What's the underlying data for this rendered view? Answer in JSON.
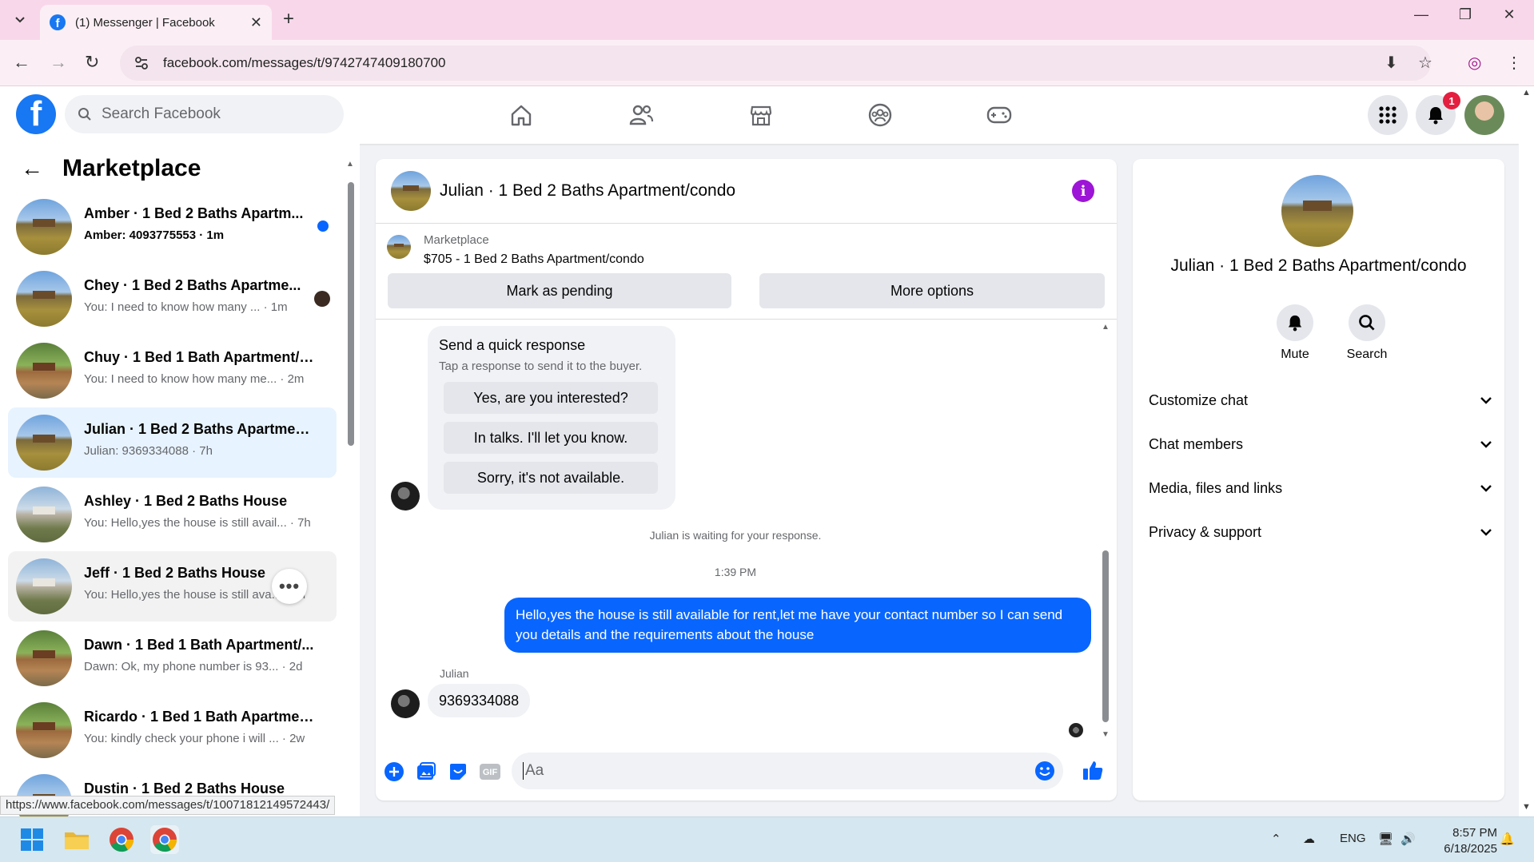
{
  "browser": {
    "tab_title": "(1) Messenger | Facebook",
    "url": "facebook.com/messages/t/9742747409180700",
    "status_url": "https://www.facebook.com/messages/t/10071812149572443/"
  },
  "fb_header": {
    "search_placeholder": "Search Facebook",
    "notification_count": "1"
  },
  "sidebar": {
    "title": "Marketplace",
    "conversations": [
      {
        "name": "Amber · 1 Bed 2 Baths Apartm...",
        "preview": "Amber: 4093775553 · 1m",
        "unread": true
      },
      {
        "name": "Chey · 1 Bed 2 Baths Apartme...",
        "preview": "You: I need to know how many ... · 1m"
      },
      {
        "name": "Chuy · 1 Bed 1 Bath Apartment/c...",
        "preview": "You: I need to know how many me... · 2m"
      },
      {
        "name": "Julian · 1 Bed 2 Baths Apartment...",
        "preview": "Julian: 9369334088 · 7h",
        "selected": true
      },
      {
        "name": "Ashley · 1 Bed 2 Baths House",
        "preview": "You: Hello,yes the house is still avail... · 7h"
      },
      {
        "name": "Jeff · 1 Bed 2 Baths House",
        "preview": "You: Hello,yes the house is still ava... · 7h"
      },
      {
        "name": "Dawn · 1 Bed 1 Bath Apartment/...",
        "preview": "Dawn: Ok, my phone number is 93... · 2d"
      },
      {
        "name": "Ricardo · 1 Bed 1 Bath Apartmen...",
        "preview": "You: kindly check your phone i will ... · 2w"
      },
      {
        "name": "Dustin · 1 Bed 2 Baths House",
        "preview": ""
      }
    ]
  },
  "chat": {
    "title": "Julian · 1 Bed 2 Baths Apartment/condo",
    "listing_label": "Marketplace",
    "listing_detail": "$705 - 1 Bed 2 Baths Apartment/condo",
    "mark_pending": "Mark as pending",
    "more_options": "More options",
    "quick_response": {
      "heading": "Send a quick response",
      "subheading": "Tap a response to send it to the buyer.",
      "options": [
        "Yes, are you interested?",
        "In talks. I'll let you know.",
        "Sorry, it's not available."
      ]
    },
    "waiting_text": "Julian is waiting for your response.",
    "timestamp": "1:39 PM",
    "outgoing_message": "Hello,yes the house is still available for rent,let me have your contact number   so I can send you details and the requirements about the house",
    "sender_name": "Julian",
    "incoming_message": "9369334088",
    "composer_placeholder": "Aa"
  },
  "details": {
    "name": "Julian · 1 Bed 2 Baths Apartment/condo",
    "mute_label": "Mute",
    "search_label": "Search",
    "sections": [
      "Customize chat",
      "Chat members",
      "Media, files and links",
      "Privacy & support"
    ]
  },
  "taskbar": {
    "lang": "ENG",
    "time": "8:57 PM",
    "date": "6/18/2025"
  },
  "colors": {
    "fb_blue": "#1877f2",
    "messenger_blue": "#0866ff",
    "info_purple": "#9d15d6",
    "badge_red": "#e41e3f"
  }
}
